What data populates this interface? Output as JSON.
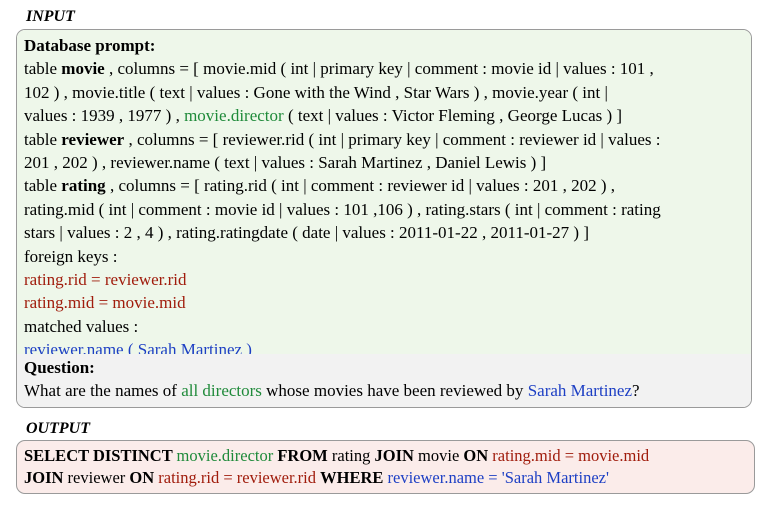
{
  "labels": {
    "input": "INPUT",
    "output": "OUTPUT"
  },
  "prompt": {
    "heading": "Database prompt:",
    "lines": [
      [
        {
          "t": "table ",
          "s": ""
        },
        {
          "t": "movie",
          "s": "b"
        },
        {
          "t": " , columns = [ movie.mid ( int | primary key | comment : movie id | values : 101 ,",
          "s": ""
        }
      ],
      [
        {
          "t": "102 ) , movie.title ( text | values : Gone with the Wind , Star Wars ) , movie.year ( int |",
          "s": ""
        }
      ],
      [
        {
          "t": "values : 1939 , 1977 ) , ",
          "s": ""
        },
        {
          "t": "movie.director",
          "s": "green"
        },
        {
          "t": " ( text | values : Victor Fleming , George Lucas ) ]",
          "s": ""
        }
      ],
      [
        {
          "t": "table ",
          "s": ""
        },
        {
          "t": "reviewer",
          "s": "b"
        },
        {
          "t": " , columns = [ reviewer.rid ( int | primary key | comment : reviewer id | values :",
          "s": ""
        }
      ],
      [
        {
          "t": "201 , 202 ) , reviewer.name ( text | values : Sarah Martinez , Daniel Lewis ) ]",
          "s": ""
        }
      ],
      [
        {
          "t": "table ",
          "s": ""
        },
        {
          "t": "rating",
          "s": "b"
        },
        {
          "t": " , columns = [ rating.rid ( int | comment : reviewer id | values : 201 , 202 ) ,",
          "s": ""
        }
      ],
      [
        {
          "t": "rating.mid ( int | comment : movie id | values : 101 ,106 ) , rating.stars ( int | comment : rating",
          "s": ""
        }
      ],
      [
        {
          "t": "stars | values : 2 , 4 ) , rating.ratingdate ( date | values : 2011-01-22 , 2011-01-27 ) ]",
          "s": ""
        }
      ],
      [
        {
          "t": "foreign keys :",
          "s": ""
        }
      ],
      [
        {
          "t": "rating.rid = reviewer.rid",
          "s": "red"
        }
      ],
      [
        {
          "t": "rating.mid = movie.mid",
          "s": "red"
        }
      ],
      [
        {
          "t": "matched values :",
          "s": ""
        }
      ],
      [
        {
          "t": "reviewer.name ( Sarah Martinez )",
          "s": "blue"
        }
      ]
    ]
  },
  "question": {
    "heading": "Question:",
    "segments": [
      {
        "t": "What are the names of ",
        "s": ""
      },
      {
        "t": "all directors",
        "s": "green"
      },
      {
        "t": " whose movies have been reviewed by ",
        "s": ""
      },
      {
        "t": "Sarah Martinez",
        "s": "blue"
      },
      {
        "t": "?",
        "s": ""
      }
    ]
  },
  "output": {
    "lines": [
      [
        {
          "t": "SELECT DISTINCT ",
          "s": "b"
        },
        {
          "t": "movie.director ",
          "s": "green"
        },
        {
          "t": "FROM ",
          "s": "b"
        },
        {
          "t": "rating ",
          "s": ""
        },
        {
          "t": "JOIN ",
          "s": "b"
        },
        {
          "t": "movie ",
          "s": ""
        },
        {
          "t": "ON ",
          "s": "b"
        },
        {
          "t": "rating.mid  =  movie.mid",
          "s": "red"
        }
      ],
      [
        {
          "t": "JOIN ",
          "s": "b"
        },
        {
          "t": "reviewer ",
          "s": ""
        },
        {
          "t": "ON ",
          "s": "b"
        },
        {
          "t": "rating.rid  =  reviewer.rid ",
          "s": "red"
        },
        {
          "t": "WHERE ",
          "s": "b"
        },
        {
          "t": "reviewer.name  =  'Sarah Martinez'",
          "s": "blue"
        }
      ]
    ]
  },
  "colors": {
    "green": "#1f8a3a",
    "red": "#a01c0c",
    "blue": "#1d3fc4",
    "input_bg": "#eef7ea",
    "question_bg": "#f2f2f2",
    "output_bg": "#fbecea"
  }
}
